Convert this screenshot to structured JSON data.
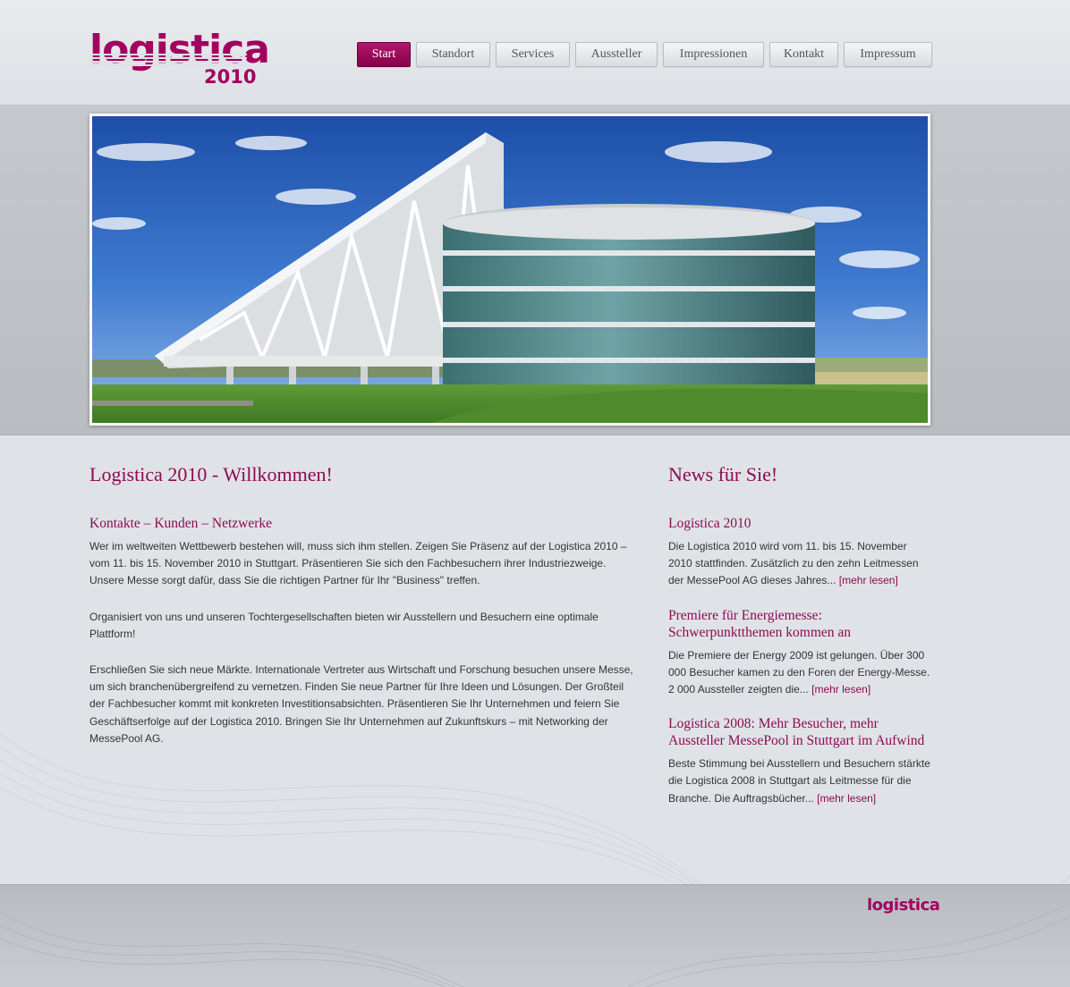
{
  "logo": {
    "word": "logistica",
    "year": "2010"
  },
  "nav": {
    "items": [
      {
        "label": "Start",
        "active": true
      },
      {
        "label": "Standort"
      },
      {
        "label": "Services"
      },
      {
        "label": "Aussteller"
      },
      {
        "label": "Impressionen"
      },
      {
        "label": "Kontakt"
      },
      {
        "label": "Impressum"
      }
    ]
  },
  "main": {
    "title": "Logistica 2010 - Willkommen!",
    "subtitle": "Kontakte – Kunden – Netzwerke",
    "paragraphs": [
      "Wer im weltweiten Wettbewerb bestehen will, muss sich ihm stellen. Zeigen Sie Präsenz auf der Logistica 2010 – vom 11. bis 15. November 2010 in Stuttgart. Präsentieren Sie sich den Fachbesuchern ihrer Industriezweige. Unsere Messe sorgt dafür, dass Sie die richtigen Partner für Ihr \"Business\" treffen.",
      "Organisiert von uns und unseren Tochtergesellschaften bieten wir Ausstellern und Besuchern eine optimale Plattform!",
      "Erschließen Sie sich neue Märkte. Internationale Vertreter aus Wirtschaft und Forschung besuchen unsere Messe, um sich branchenübergreifend zu vernetzen. Finden Sie neue Partner für Ihre Ideen und Lösungen. Der Großteil der Fachbesucher kommt mit konkreten Investitionsabsichten. Präsentieren Sie Ihr Unternehmen und feiern Sie Geschäftserfolge auf der Logistica 2010. Bringen Sie Ihr Unternehmen auf Zukunftskurs – mit Networking der MessePool AG."
    ]
  },
  "news": {
    "title": "News für Sie!",
    "items": [
      {
        "title": "Logistica 2010",
        "text": "Die Logistica 2010 wird vom 11. bis 15. November 2010 stattfinden. Zusätzlich zu den zehn Leitmessen der MessePool AG dieses Jahres...",
        "more": "[mehr lesen]"
      },
      {
        "title": "Premiere für Energiemesse: Schwerpunktthemen kommen an",
        "text": "Die Premiere der Energy 2009 ist gelungen. Über 300 000 Besucher kamen zu den Foren der Energy-Messe. 2 000 Aussteller zeigten die...",
        "more": "[mehr lesen]"
      },
      {
        "title": "Logistica 2008: Mehr Besucher, mehr Aussteller MessePool in Stuttgart im Aufwind",
        "text": "Beste Stimmung bei Ausstellern und Besuchern stärkte die Logistica 2008 in Stuttgart als Leitmesse für die Branche. Die Auftragsbücher...",
        "more": "[mehr lesen]"
      }
    ]
  },
  "footer": {
    "logo": "logistica"
  },
  "colors": {
    "accent": "#8e0a52",
    "brand": "#a3005f",
    "background": "#dfe3e7"
  }
}
